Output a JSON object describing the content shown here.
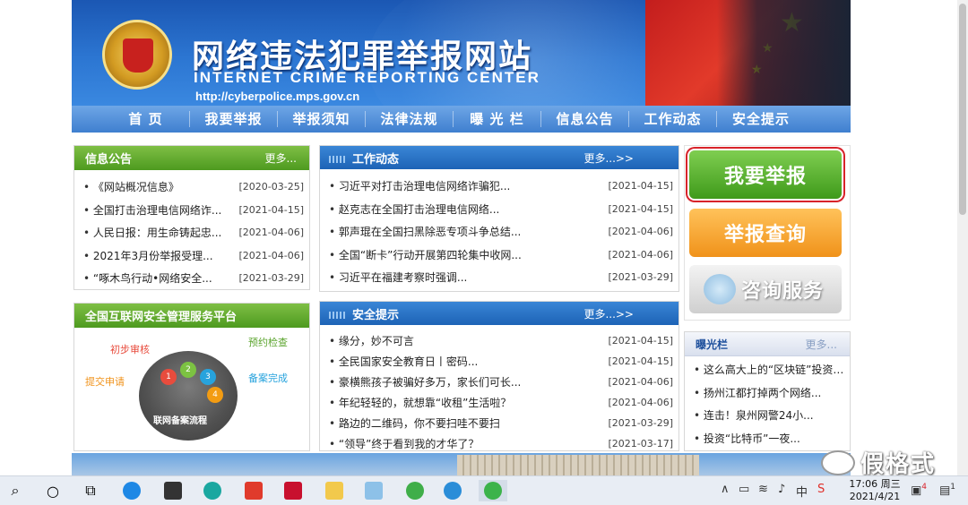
{
  "banner": {
    "title_cn": "网络违法犯罪举报网站",
    "title_en": "INTERNET CRIME REPORTING CENTER",
    "url": "http://cyberpolice.mps.gov.cn"
  },
  "nav": [
    "首 页",
    "我要举报",
    "举报须知",
    "法律法规",
    "曝 光 栏",
    "信息公告",
    "工作动态",
    "安全提示"
  ],
  "info_notice": {
    "title": "信息公告",
    "more": "更多...",
    "items": [
      {
        "title": "《网站概况信息》",
        "date": "[2020-03-25]"
      },
      {
        "title": "全国打击治理电信网络诈...",
        "date": "[2021-04-15]"
      },
      {
        "title": "人民日报：用生命铸起忠...",
        "date": "[2021-04-06]"
      },
      {
        "title": "2021年3月份举报受理...",
        "date": "[2021-04-06]"
      },
      {
        "title": "“啄木鸟行动•网络安全...",
        "date": "[2021-03-29]"
      }
    ]
  },
  "platform": {
    "title": "全国互联网安全管理服务平台",
    "steps": [
      "初步审核",
      "预约检查",
      "提交申请",
      "备案完成"
    ],
    "center": "联网备案流程",
    "numbers": [
      "1",
      "2",
      "3",
      "4"
    ]
  },
  "work_news": {
    "title": "工作动态",
    "more": "更多...>>",
    "items": [
      {
        "title": "习近平对打击治理电信网络诈骗犯...",
        "date": "[2021-04-15]"
      },
      {
        "title": "赵克志在全国打击治理电信网络...",
        "date": "[2021-04-15]"
      },
      {
        "title": "郭声琨在全国扫黑除恶专项斗争总结...",
        "date": "[2021-04-06]"
      },
      {
        "title": "全国“断卡”行动开展第四轮集中收网...",
        "date": "[2021-04-06]"
      },
      {
        "title": "习近平在福建考察时强调...",
        "date": "[2021-03-29]"
      }
    ]
  },
  "safety_tips": {
    "title": "安全提示",
    "more": "更多...>>",
    "items": [
      {
        "title": "缘分，妙不可言",
        "date": "[2021-04-15]"
      },
      {
        "title": "全民国家安全教育日丨密码...",
        "date": "[2021-04-15]"
      },
      {
        "title": "豪横熊孩子被骗好多万，家长们可长...",
        "date": "[2021-04-06]"
      },
      {
        "title": "年纪轻轻的，就想靠“收租”生活啦？",
        "date": "[2021-04-06]"
      },
      {
        "title": "路边的二维码，你不要扫哇不要扫",
        "date": "[2021-03-29]"
      },
      {
        "title": "“领导”终于看到我的才华了？",
        "date": "[2021-03-17]"
      }
    ]
  },
  "actions": {
    "report": "我要举报",
    "query": "举报查询",
    "consult": "咨询服务"
  },
  "exposure": {
    "title": "曝光栏",
    "more": "更多...",
    "items": [
      "这么高大上的“区块链”投资”...",
      "扬州江都打掉两个网络...",
      "连击！泉州网警24小...",
      "投资“比特币”一夜..."
    ]
  },
  "watermark": "假格式",
  "taskbar": {
    "time": "17:06 周三",
    "date": "2021/4/21",
    "ime": "中",
    "notif_count": "1",
    "badge": "4"
  },
  "colors": {
    "banner_blue": "#2c76d2",
    "nav_blue": "#3f7fcf",
    "green_head": "#4d9a1f",
    "report_green": "#3f9a1b",
    "query_orange": "#f0921a",
    "highlight_red": "#d8232a"
  }
}
